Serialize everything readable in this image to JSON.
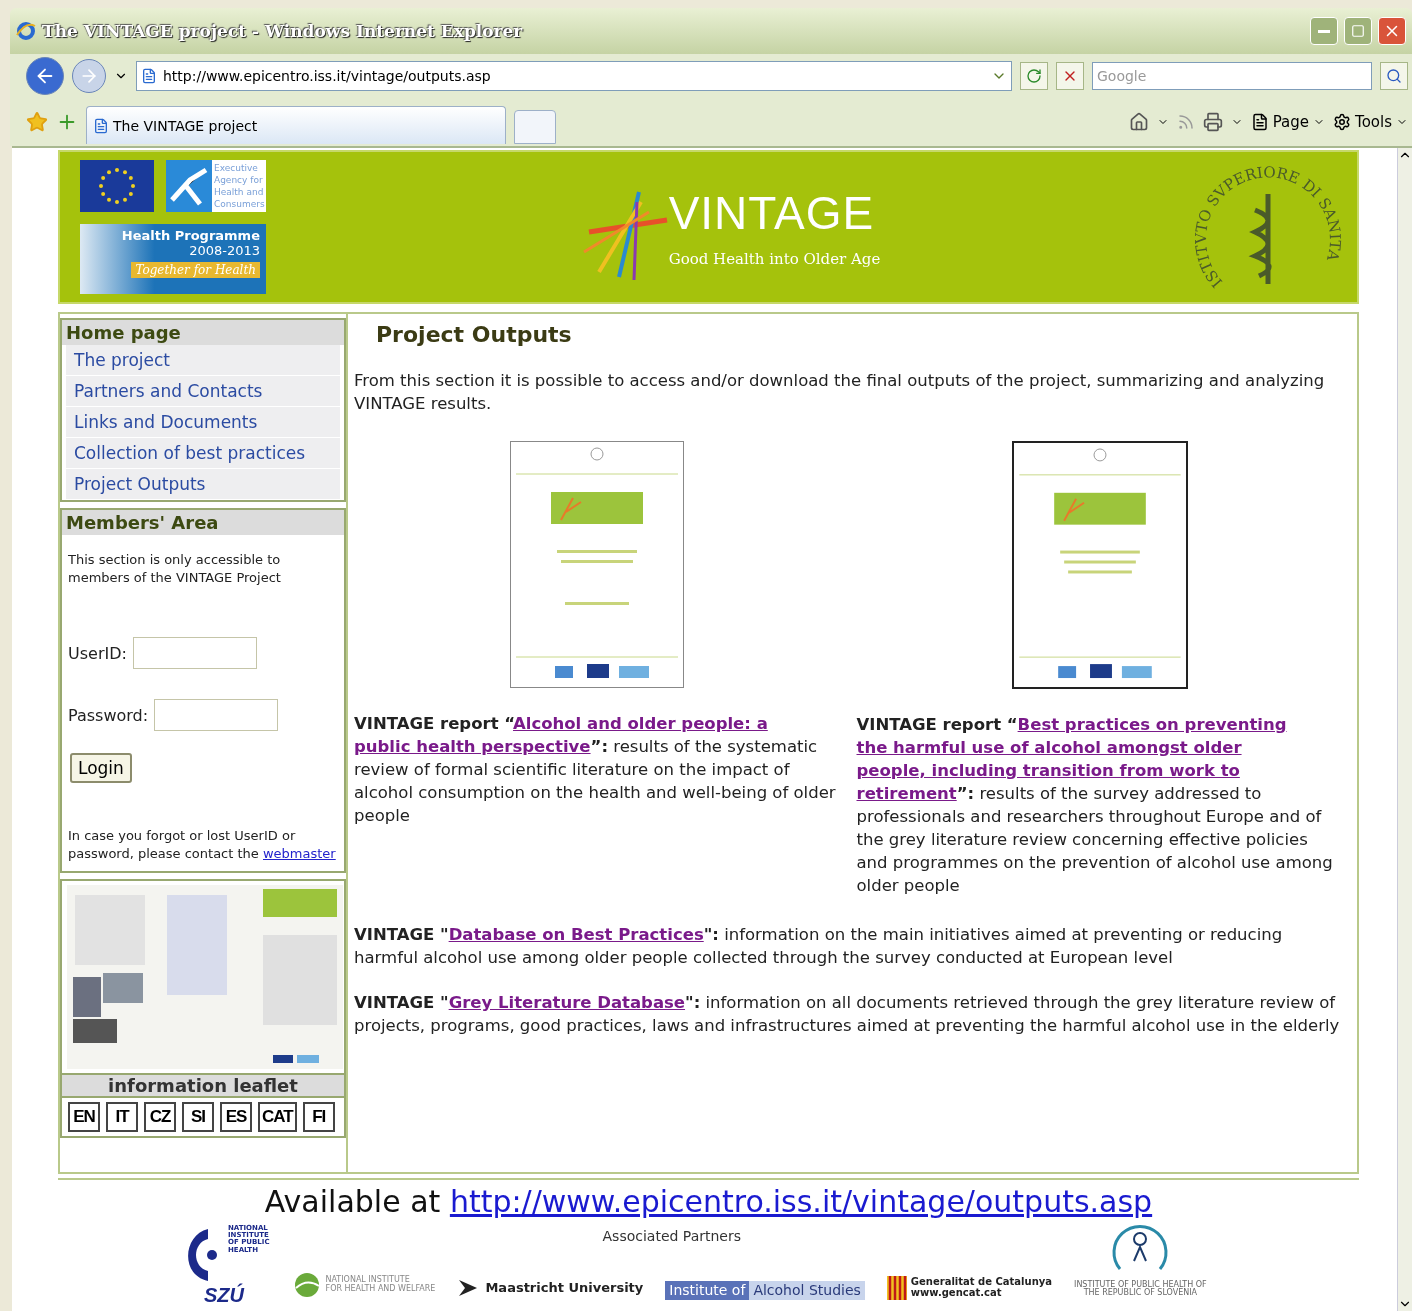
{
  "window": {
    "title": "The VINTAGE project - Windows Internet Explorer"
  },
  "address_bar": {
    "value": "http://www.epicentro.iss.it/vintage/outputs.asp"
  },
  "search": {
    "placeholder": "Google"
  },
  "tabs": [
    {
      "label": "The VINTAGE project",
      "selected": true
    }
  ],
  "toolbar": [
    "Page",
    "Tools"
  ],
  "banner": {
    "agency": [
      "Executive",
      "Agency for",
      "Health and",
      "Consumers"
    ],
    "programme": {
      "title": "Health Programme",
      "years": "2008-2013",
      "slogan": "Together for Health"
    },
    "title": "VINTAGE",
    "subtitle": "Good Health into Older Age",
    "seal": "ISTITVTO SVPERIORE DI SANITA"
  },
  "sidebar": {
    "menu_title": "Home page",
    "menu": [
      "The project",
      "Partners and Contacts",
      "Links and Documents",
      "Collection of best practices",
      "Project Outputs"
    ],
    "members": {
      "title": "Members' Area",
      "note": "This section is only accessible to members of the VINTAGE Project",
      "fields": [
        {
          "label": "UserID:"
        },
        {
          "label": "Password:"
        }
      ],
      "button": "Login",
      "help": "In case you forgot or lost UserID or password, please contact the",
      "help_link": "webmaster"
    },
    "leaflet": {
      "caption": "information leaflet",
      "languages": [
        "EN",
        "IT",
        "CZ",
        "SI",
        "ES",
        "CAT",
        "FI"
      ]
    }
  },
  "content": {
    "title": "Project Outputs",
    "intro": "From this section it is possible to access and/or download the final outputs of the project, summarizing and analyzing VINTAGE results.",
    "reports": [
      {
        "lead": "VINTAGE report “",
        "link": [
          "Alcohol and older people: a",
          "public health perspective"
        ],
        "close": "”:",
        "text": " results of the systematic review of formal scientific literature on the impact of alcohol consumption on the health and well-being of older people",
        "framed": false
      },
      {
        "lead": "VINTAGE report “",
        "link": [
          "Best practices on preventing",
          "the harmful use of alcohol amongst older",
          "people, including transition from work to",
          "retirement"
        ],
        "close": "”:",
        "text": " results of the survey addressed to professionals and researchers throughout Europe and of the grey literature review concerning effective policies and programmes on the prevention of alcohol use among older people",
        "framed": true
      }
    ],
    "databases": [
      {
        "lead": "VINTAGE \"",
        "link": [
          "Database on Best Practices"
        ],
        "close": "\":",
        "text": " information on the main initiatives aimed at preventing or reducing harmful alcohol use among older people collected through the survey conducted at European level"
      },
      {
        "lead": "VINTAGE \"",
        "link": [
          "Grey Literature Database"
        ],
        "close": "\":",
        "text": " information on all documents retrieved through the grey literature review of projects, programs, good practices, laws and infrastructures aimed at preventing the harmful alcohol use in the elderly"
      }
    ]
  },
  "footer": {
    "available": "Available at",
    "url": "http://www.epicentro.iss.it/vintage/outputs.asp",
    "partners_title": "Associated Partners",
    "partners": [
      {
        "kind": "szu",
        "lines": [
          "NATIONAL",
          "INSTITUTE",
          "OF PUBLIC",
          "HEALTH"
        ],
        "mark": "SZÚ"
      },
      {
        "kind": "thl",
        "lines": [
          "NATIONAL INSTITUTE",
          "FOR HEALTH AND WELFARE"
        ]
      },
      {
        "kind": "maastricht",
        "lines": [
          "Maastricht University"
        ]
      },
      {
        "kind": "ias",
        "lines": [
          "Institute of",
          "Alcohol Studies"
        ]
      },
      {
        "kind": "gencat",
        "lines": [
          "Generalitat de Catalunya",
          "www.gencat.cat"
        ]
      },
      {
        "kind": "ivz",
        "lines": [
          "INSTITUTE OF PUBLIC HEALTH OF",
          "THE REPUBLIC OF SLOVENIA"
        ]
      }
    ]
  }
}
